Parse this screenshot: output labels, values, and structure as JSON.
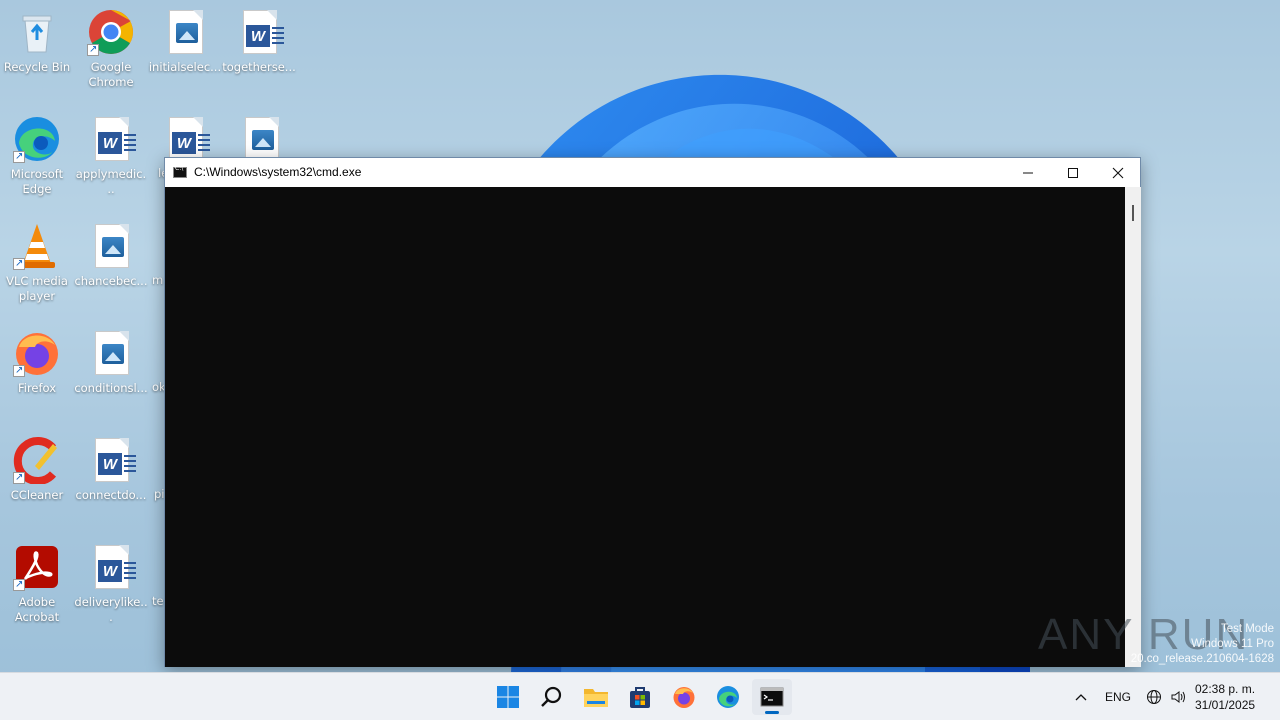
{
  "desktop": {
    "icons": [
      {
        "label": "Recycle Bin"
      },
      {
        "label": "Google Chrome"
      },
      {
        "label": "initialselec..."
      },
      {
        "label": "togetherse..."
      },
      {
        "label": "Microsoft Edge"
      },
      {
        "label": "applymedic..."
      },
      {
        "label": "VLC media player"
      },
      {
        "label": "chancebec..."
      },
      {
        "label": "Firefox"
      },
      {
        "label": "conditionsl..."
      },
      {
        "label": "CCleaner"
      },
      {
        "label": "connectdo..."
      },
      {
        "label": "Adobe Acrobat"
      },
      {
        "label": "deliverylike..."
      }
    ],
    "clipped": [
      "le",
      "m",
      "ok",
      "pi",
      "te"
    ]
  },
  "window": {
    "title": "C:\\Windows\\system32\\cmd.exe",
    "minimize_icon": "minimize-icon",
    "maximize_icon": "maximize-icon",
    "close_icon": "close-icon",
    "console_bg": "#0c0c0c"
  },
  "watermark": {
    "brand": "ANY RUN",
    "line1": "Test Mode",
    "line2": "Windows 11 Pro",
    "line3": "20.co_release.210604-1628"
  },
  "taskbar": {
    "apps": [
      "start-icon",
      "search-icon",
      "file-explorer-icon",
      "store-icon",
      "firefox-icon",
      "edge-icon",
      "cmd-icon"
    ],
    "language": "ENG",
    "time": "02:38 p. m.",
    "date": "31/01/2025",
    "accent": "#0067c0"
  }
}
